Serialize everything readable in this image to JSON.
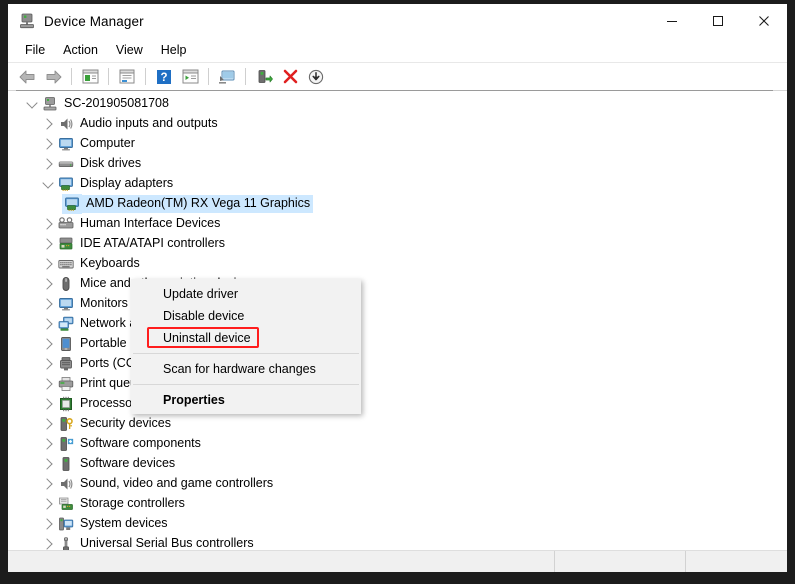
{
  "window": {
    "title": "Device Manager",
    "title_icon": "device-manager-icon",
    "caption": {
      "minimize": "—",
      "maximize": "☐",
      "close": "✕"
    }
  },
  "menubar": {
    "items": [
      {
        "label": "File"
      },
      {
        "label": "Action"
      },
      {
        "label": "View"
      },
      {
        "label": "Help"
      }
    ]
  },
  "toolbar": {
    "buttons": [
      {
        "name": "back-button",
        "icon": "left-arrow-icon"
      },
      {
        "name": "forward-button",
        "icon": "right-arrow-icon"
      },
      {
        "name": "separator-1",
        "icon": "separator"
      },
      {
        "name": "show-hide-console-tree-button",
        "icon": "console-tree-icon"
      },
      {
        "name": "separator-2",
        "icon": "separator"
      },
      {
        "name": "properties-button",
        "icon": "properties-window-icon"
      },
      {
        "name": "separator-3",
        "icon": "separator"
      },
      {
        "name": "help-button",
        "icon": "question-mark-icon"
      },
      {
        "name": "action-menu-button",
        "icon": "action-list-icon"
      },
      {
        "name": "separator-4",
        "icon": "separator"
      },
      {
        "name": "scan-hardware-changes-button",
        "icon": "monitor-scan-icon"
      },
      {
        "name": "separator-5",
        "icon": "separator"
      },
      {
        "name": "update-driver-button",
        "icon": "update-driver-icon"
      },
      {
        "name": "uninstall-device-button",
        "icon": "red-x-icon"
      },
      {
        "name": "disable-device-button",
        "icon": "down-arrow-circle-icon"
      }
    ]
  },
  "tree": {
    "root": {
      "label": "SC-201905081708",
      "icon": "computer-root-icon",
      "expanded": true
    },
    "items": [
      {
        "label": "Audio inputs and outputs",
        "icon": "speaker-icon",
        "expanded": false,
        "level": 1
      },
      {
        "label": "Computer",
        "icon": "monitor-icon",
        "expanded": false,
        "level": 1
      },
      {
        "label": "Disk drives",
        "icon": "disk-drive-icon",
        "expanded": false,
        "level": 1
      },
      {
        "label": "Display adapters",
        "icon": "display-adapter-icon",
        "expanded": true,
        "level": 1
      },
      {
        "label": "AMD Radeon(TM) RX Vega 11 Graphics",
        "icon": "display-adapter-icon",
        "expanded": null,
        "level": 2,
        "selected": true
      },
      {
        "label": "Human Interface Devices",
        "icon": "hid-icon",
        "expanded": false,
        "level": 1
      },
      {
        "label": "IDE ATA/ATAPI controllers",
        "icon": "ide-controller-icon",
        "expanded": false,
        "level": 1
      },
      {
        "label": "Keyboards",
        "icon": "keyboard-icon",
        "expanded": false,
        "level": 1
      },
      {
        "label": "Mice and other pointing devices",
        "icon": "mouse-icon",
        "expanded": false,
        "level": 1
      },
      {
        "label": "Monitors",
        "icon": "monitor-icon",
        "expanded": false,
        "level": 1
      },
      {
        "label": "Network adapters",
        "icon": "network-adapter-icon",
        "expanded": false,
        "level": 1
      },
      {
        "label": "Portable Devices",
        "icon": "portable-device-icon",
        "expanded": false,
        "level": 1
      },
      {
        "label": "Ports (COM & LPT)",
        "icon": "port-icon",
        "expanded": false,
        "level": 1
      },
      {
        "label": "Print queues",
        "icon": "printer-icon",
        "expanded": false,
        "level": 1
      },
      {
        "label": "Processors",
        "icon": "processor-icon",
        "expanded": false,
        "level": 1
      },
      {
        "label": "Security devices",
        "icon": "security-device-icon",
        "expanded": false,
        "level": 1
      },
      {
        "label": "Software components",
        "icon": "software-component-icon",
        "expanded": false,
        "level": 1
      },
      {
        "label": "Software devices",
        "icon": "software-device-icon",
        "expanded": false,
        "level": 1
      },
      {
        "label": "Sound, video and game controllers",
        "icon": "speaker-icon",
        "expanded": false,
        "level": 1
      },
      {
        "label": "Storage controllers",
        "icon": "storage-controller-icon",
        "expanded": false,
        "level": 1
      },
      {
        "label": "System devices",
        "icon": "system-device-icon",
        "expanded": false,
        "level": 1
      },
      {
        "label": "Universal Serial Bus controllers",
        "icon": "usb-icon",
        "expanded": false,
        "level": 1
      }
    ]
  },
  "context_menu": {
    "items": [
      {
        "label": "Update driver",
        "bold": false,
        "highlighted": false
      },
      {
        "label": "Disable device",
        "bold": false,
        "highlighted": false
      },
      {
        "label": "Uninstall device",
        "bold": false,
        "highlighted": true
      },
      {
        "label": "Scan for hardware changes",
        "bold": false,
        "highlighted": false
      },
      {
        "label": "Properties",
        "bold": true,
        "highlighted": false
      }
    ]
  },
  "annotation": {
    "color": "#ff1d1d",
    "target": "Uninstall device"
  },
  "statusbar": {
    "main": "",
    "cell2": "",
    "cell3": ""
  }
}
